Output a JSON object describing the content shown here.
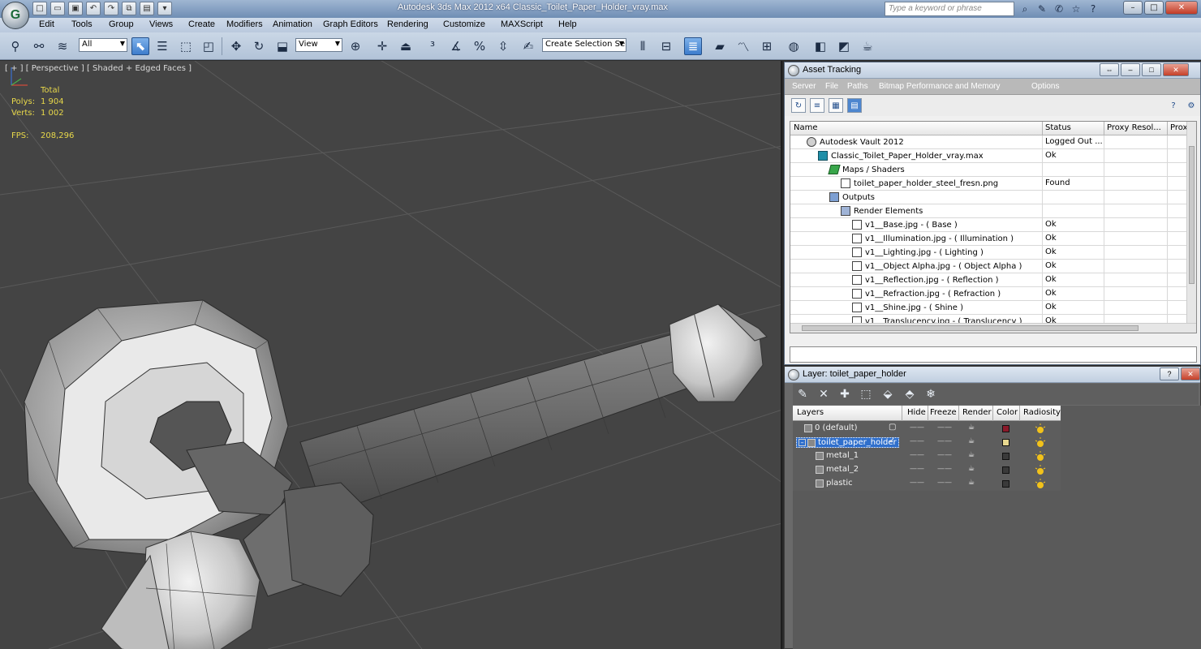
{
  "window": {
    "title": "Autodesk 3ds Max  2012 x64      Classic_Toilet_Paper_Holder_vray.max",
    "search_placeholder": "Type a keyword or phrase"
  },
  "menu": [
    "Edit",
    "Tools",
    "Group",
    "Views",
    "Create",
    "Modifiers",
    "Animation",
    "Graph Editors",
    "Rendering",
    "Customize",
    "MAXScript",
    "Help"
  ],
  "toolbar": {
    "selection_filter": "All",
    "reference_coord": "View",
    "named_selection_placeholder": "Create Selection Se"
  },
  "viewport": {
    "label": "[ + ] [ Perspective ] [ Shaded + Edged Faces ]",
    "stats_header": "Total",
    "polys_label": "Polys:",
    "polys_value": "1 904",
    "verts_label": "Verts:",
    "verts_value": "1 002",
    "fps_label": "FPS:",
    "fps_value": "208,296"
  },
  "asset_tracking": {
    "title": "Asset Tracking",
    "menu": [
      "Server",
      "File",
      "Paths",
      "Bitmap Performance and Memory",
      "Options"
    ],
    "columns": [
      "Name",
      "Status",
      "Proxy Resol...",
      "Prox"
    ],
    "rows": [
      {
        "name": "Autodesk Vault 2012",
        "status": "Logged Out ...",
        "icon": "vault-icon"
      },
      {
        "name": "Classic_Toilet_Paper_Holder_vray.max",
        "status": "Ok",
        "icon": "max-file-icon"
      },
      {
        "name": "Maps / Shaders",
        "status": "",
        "icon": "maps-icon"
      },
      {
        "name": "toilet_paper_holder_steel_fresn.png",
        "status": "Found",
        "icon": "bitmap-icon"
      },
      {
        "name": "Outputs",
        "status": "",
        "icon": "outputs-icon"
      },
      {
        "name": "Render Elements",
        "status": "",
        "icon": "render-elements-icon"
      },
      {
        "name": "v1__Base.jpg -  ( Base )",
        "status": "Ok",
        "icon": "bitmap-icon"
      },
      {
        "name": "v1__Illumination.jpg -  ( Illumination )",
        "status": "Ok",
        "icon": "bitmap-icon"
      },
      {
        "name": "v1__Lighting.jpg -  ( Lighting )",
        "status": "Ok",
        "icon": "bitmap-icon"
      },
      {
        "name": "v1__Object Alpha.jpg -  ( Object Alpha )",
        "status": "Ok",
        "icon": "bitmap-icon"
      },
      {
        "name": "v1__Reflection.jpg -  ( Reflection )",
        "status": "Ok",
        "icon": "bitmap-icon"
      },
      {
        "name": "v1__Refraction.jpg -  ( Refraction )",
        "status": "Ok",
        "icon": "bitmap-icon"
      },
      {
        "name": "v1__Shine.jpg -  ( Shine )",
        "status": "Ok",
        "icon": "bitmap-icon"
      },
      {
        "name": "v1__Translucency.jpg -  ( Translucency )",
        "status": "Ok",
        "icon": "bitmap-icon"
      }
    ]
  },
  "layers": {
    "title": "Layer: toilet_paper_holder",
    "columns": [
      "Layers",
      "Hide",
      "Freeze",
      "Render",
      "Color",
      "Radiosity"
    ],
    "rows": [
      {
        "name": "0 (default)",
        "color": "#8b1a2a"
      },
      {
        "name": "toilet_paper_holder",
        "color": "#e8d890"
      },
      {
        "name": "metal_1",
        "color": "#3a3a3a"
      },
      {
        "name": "metal_2",
        "color": "#3a3a3a"
      },
      {
        "name": "plastic",
        "color": "#3a3a3a"
      }
    ]
  },
  "colors": {
    "accent": "#3d7ccc",
    "viewport_bg": "#444444",
    "stats": "#e8d84a"
  }
}
